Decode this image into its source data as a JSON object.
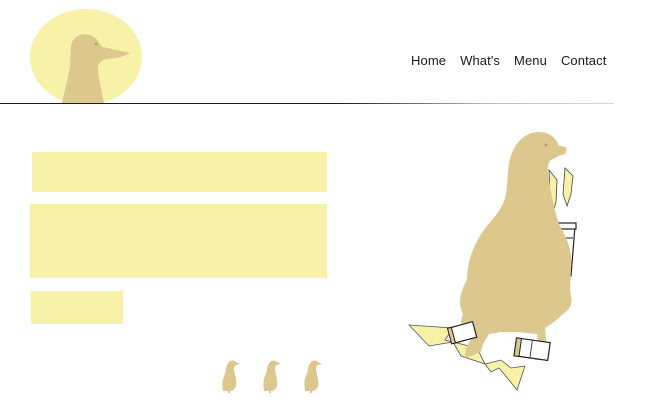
{
  "nav": {
    "items": [
      {
        "label": "Home"
      },
      {
        "label": "What's"
      },
      {
        "label": "Menu"
      },
      {
        "label": "Contact"
      }
    ]
  },
  "colors": {
    "duck": "#dcc78d",
    "accent_yellow": "#f8f1a8",
    "text": "#1a1a1a"
  },
  "icons": {
    "logo": "duck-head-icon",
    "ducklings": "duckling-icon",
    "hero": "duck-with-coffee-cups-illustration"
  }
}
